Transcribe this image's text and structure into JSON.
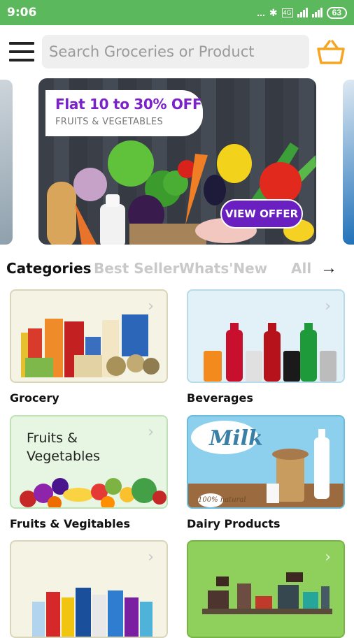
{
  "status_bar": {
    "time": "9:06",
    "indicators": "...",
    "net_badge": "4G",
    "battery": "63"
  },
  "header": {
    "search_placeholder": "Search Groceries or Product",
    "menu_icon": "hamburger-menu-icon",
    "cart_icon": "basket-icon"
  },
  "banner": {
    "headline": "Flat 10 to 30% OFF",
    "subline": "FRUITS & VEGETABLES",
    "cta_label": "VIEW OFFER"
  },
  "tabs": [
    {
      "label": "Categories",
      "active": true
    },
    {
      "label": "Best Seller",
      "active": false
    },
    {
      "label": "Whats'New",
      "active": false
    },
    {
      "label": "All",
      "active": false
    }
  ],
  "tabs_arrow": "→",
  "categories": [
    {
      "label": "Grocery",
      "bg": "#f4f3e4",
      "border": "#d8d5b8"
    },
    {
      "label": "Beverages",
      "bg": "#e2f1f8",
      "border": "#b7dbe8"
    },
    {
      "label": "Fruits & Vegitables",
      "bg": "#e7f6e2",
      "border": "#bfe1b6",
      "card_title_line1": "Fruits &",
      "card_title_line2": "Vegetables"
    },
    {
      "label": "Dairy Products",
      "bg": "#8cd0ee",
      "border": "#6bbcdc",
      "card_title": "Milk",
      "badge": "100% natural"
    },
    {
      "label": "",
      "bg": "#f4f3e4",
      "border": "#d8d5b8"
    },
    {
      "label": "",
      "bg": "#8fcf5c",
      "border": "#76b545"
    }
  ],
  "colors": {
    "status_bar": "#5cb85c",
    "accent_purple": "#7b22c9",
    "basket_orange": "#f5a623"
  }
}
